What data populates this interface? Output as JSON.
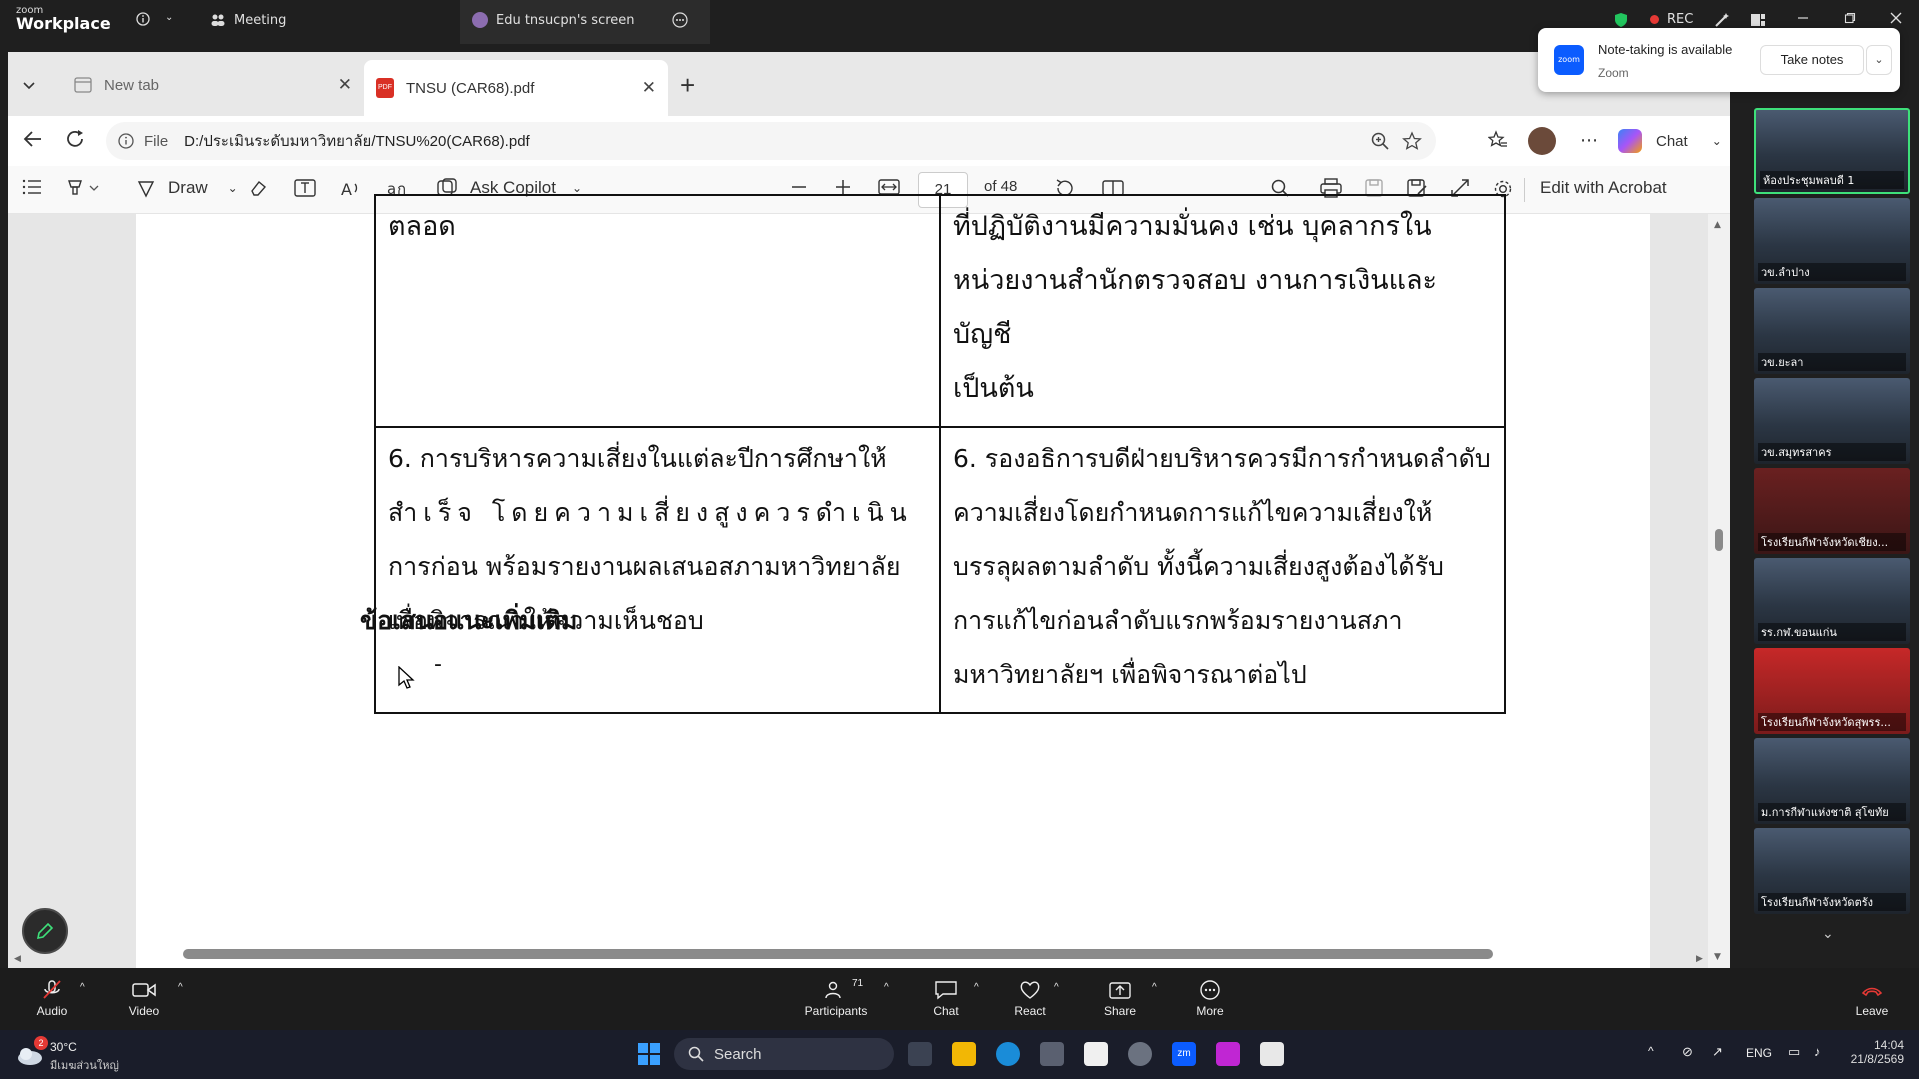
{
  "zoom": {
    "logo_small": "zoom",
    "logo_big": "Workplace",
    "meeting_label": "Meeting",
    "screen_label": "Edu tnsucpn's screen",
    "rec_label": "REC"
  },
  "notification": {
    "title": "Note-taking is available",
    "subtitle": "Zoom",
    "button": "Take notes",
    "badge": "zoom"
  },
  "browser": {
    "tabs": [
      {
        "label": "New tab"
      },
      {
        "label": "TNSU (CAR68).pdf"
      }
    ],
    "address_prefix": "File",
    "address": "D:/ประเมินระดับมหาวิทยาลัย/TNSU%20(CAR68).pdf",
    "chat_label": "Chat"
  },
  "pdf_toolbar": {
    "draw": "Draw",
    "ask_copilot": "Ask Copilot",
    "page_current": "21",
    "page_total": "of 48",
    "edit_acrobat": "Edit with Acrobat"
  },
  "document": {
    "row_top_left": "ตลอด",
    "row_top_right_lines": [
      "ที่ปฏิบัติงานมีความมั่นคง เช่น บุคลากรใน",
      "หน่วยงานสำนักตรวจสอบ งานการเงินและบัญชี",
      "เป็นต้น"
    ],
    "row6_left_lines": [
      "6. การบริหารความเสี่ยงในแต่ละปีการศึกษาให้",
      "สำเร็จ โดยความเสี่ยงสูงควรดำเนิน",
      "การก่อน พร้อมรายงานผลเสนอสภามหาวิทยาลัย",
      "เพื่อพิจารณาให้ความเห็นชอบ"
    ],
    "row6_right_lines": [
      "6. รองอธิการบดีฝ่ายบริหารควรมีการกำหนดลำดับ",
      "ความเสี่ยงโดยกำหนดการแก้ไขความเสี่ยงให้",
      "บรรลุผลตามลำดับ ทั้งนี้ความเสี่ยงสูงต้องได้รับ",
      "การแก้ไขก่อนลำดับแรกพร้อมรายงานสภา",
      "มหาวิทยาลัยฯ เพื่อพิจารณาต่อไป"
    ],
    "heading": "ข้อเสนอแนะเพิ่มเติม",
    "dash": "-"
  },
  "gallery": [
    {
      "name": "ห้องประชุมพลบดี 1"
    },
    {
      "name": "วข.ลำปาง"
    },
    {
      "name": "วข.ยะลา"
    },
    {
      "name": "วข.สมุทรสาคร"
    },
    {
      "name": "โรงเรียนกีฬาจังหวัดเชียง..."
    },
    {
      "name": "รร.กฬ.ขอนแก่น"
    },
    {
      "name": "โรงเรียนกีฬาจังหวัดสุพรร..."
    },
    {
      "name": "ม.การกีฬาแห่งชาติ สุโขทัย"
    },
    {
      "name": "โรงเรียนกีฬาจังหวัดตรัง"
    }
  ],
  "controls": {
    "audio": "Audio",
    "video": "Video",
    "participants": "Participants",
    "participant_count": "71",
    "chat": "Chat",
    "react": "React",
    "share": "Share",
    "more": "More",
    "leave": "Leave"
  },
  "taskbar": {
    "temperature": "30°C",
    "weather": "มีเมฆส่วนใหญ่",
    "weather_badge": "2",
    "search": "Search",
    "lang": "ENG",
    "time": "14:04",
    "date": "21/8/2569"
  },
  "colors": {
    "zoom_blue": "#0b5cff",
    "rec_red": "#e53935",
    "active_tile": "#3ee07a"
  }
}
